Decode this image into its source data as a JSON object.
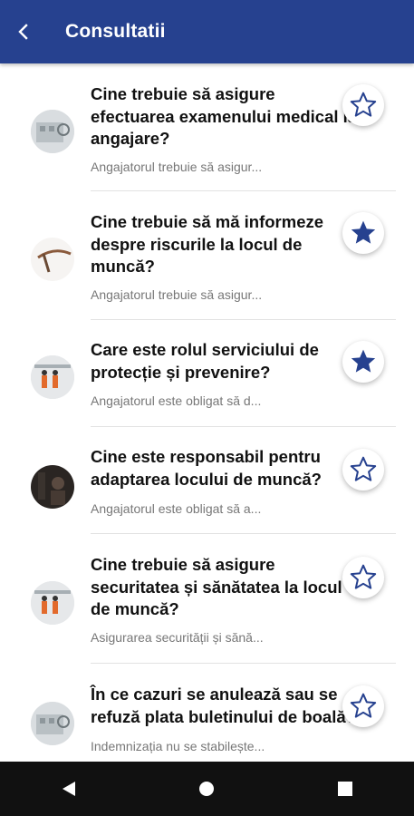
{
  "appbar": {
    "title": "Consultatii"
  },
  "items": [
    {
      "question": "Cine trebuie să asigure efectuarea examenului medical la angajare?",
      "lines": [
        "Cine trebuie să asigure",
        "efectuarea examenului medical la",
        "angajare?"
      ],
      "snippet": "Angajatorul trebuie să asigur...",
      "favorite": false,
      "icon": "building-thumbnail"
    },
    {
      "question": "Cine trebuie să mă informeze despre riscurile la locul de muncă?",
      "lines": [
        "Cine trebuie să mă informeze",
        "despre riscurile la locul de",
        "muncă?"
      ],
      "snippet": "Angajatorul trebuie să asigur...",
      "favorite": true,
      "icon": "pickaxe-thumbnail"
    },
    {
      "question": "Care este rolul serviciului de protecție și prevenire?",
      "lines": [
        "Care este rolul serviciului de",
        "protecție și prevenire?"
      ],
      "snippet": "Angajatorul este obligat să d...",
      "favorite": true,
      "icon": "workers-thumbnail"
    },
    {
      "question": "Cine este responsabil pentru adaptarea locului de muncă?",
      "lines": [
        "Cine este responsabil pentru",
        "adaptarea locului de muncă?"
      ],
      "snippet": "Angajatorul este obligat să a...",
      "favorite": false,
      "icon": "worker-thumbnail"
    },
    {
      "question": "Cine trebuie să asigure securitatea și sănătatea la locul de muncă?",
      "lines": [
        "Cine trebuie să asigure",
        "securitatea și sănătatea la locul",
        "de muncă?"
      ],
      "snippet": "Asigurarea securității și sănă...",
      "favorite": false,
      "icon": "workers-thumbnail"
    },
    {
      "question": "În ce cazuri se anulează sau se refuză plata buletinului de boală?",
      "lines": [
        "În ce cazuri se anulează sau se",
        "refuză plata buletinului de boală?"
      ],
      "snippet": "Indemnizația nu se stabilește...",
      "favorite": false,
      "icon": "building-thumbnail"
    }
  ],
  "colors": {
    "appbar": "#26418f",
    "star_filled": "#26418f",
    "star_outline": "#26418f"
  }
}
